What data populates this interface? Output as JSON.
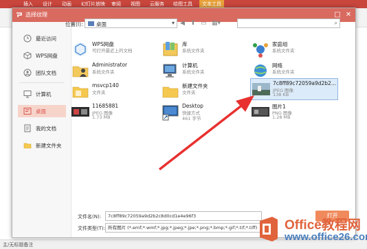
{
  "background_app": {
    "ribbon_tabs": [
      "插入",
      "设计",
      "动画",
      "幻灯片放映",
      "审阅",
      "视图",
      "云服务",
      "绘图工具",
      "文本工具"
    ],
    "status_text": "主/无标题备注",
    "accent_color": "#c9463d"
  },
  "dialog": {
    "title": "选择纹理",
    "titlebar_color": "#d96a5f",
    "buttons": {
      "maximize": "□",
      "close": "✕"
    }
  },
  "sidebar": {
    "items": [
      {
        "label": "最近访问",
        "icon": "clock-icon"
      },
      {
        "label": "WPS网盘",
        "icon": "cloud-cube-icon"
      },
      {
        "label": "团队文档",
        "icon": "team-doc-icon"
      },
      {
        "label": "计算机",
        "icon": "computer-icon"
      },
      {
        "label": "桌面",
        "icon": "desktop-icon",
        "active": true
      },
      {
        "label": "我的文档",
        "icon": "my-documents-icon"
      },
      {
        "label": "新建文件夹",
        "icon": "folder-icon"
      }
    ]
  },
  "location": {
    "label": "位置(I):",
    "value": "桌面"
  },
  "files": [
    {
      "name": "WPS网盘",
      "type": "可打开最近上的文档",
      "size": "",
      "icon": "wps-cloud-icon"
    },
    {
      "name": "库",
      "type": "系统文件夹",
      "size": "",
      "icon": "library-icon"
    },
    {
      "name": "家庭组",
      "type": "系统文件夹",
      "size": "",
      "icon": "homegroup-icon"
    },
    {
      "name": "Administrator",
      "type": "系统文件夹",
      "size": "",
      "icon": "user-folder-icon"
    },
    {
      "name": "计算机",
      "type": "系统文件夹",
      "size": "",
      "icon": "computer-icon"
    },
    {
      "name": "网络",
      "type": "系统文件夹",
      "size": "",
      "icon": "network-icon"
    },
    {
      "name": "msvcp140",
      "type": "文件夹",
      "size": "",
      "icon": "folder-icon"
    },
    {
      "name": "新建文件夹",
      "type": "文件夹",
      "size": "",
      "icon": "folder-icon"
    },
    {
      "name": "7c8ff89c72059a9d2b2c8d0cd...",
      "type": "JPEG 图像",
      "size": "138 KB",
      "icon": "image-thumbnail-icon",
      "selected": true
    },
    {
      "name": "11685881",
      "type": "JPEG 图像",
      "size": "1.73 MB",
      "icon": "image-thumbnail-icon"
    },
    {
      "name": "Desktop",
      "type": "快捷方式",
      "size": "461 字节",
      "icon": "shortcut-icon"
    },
    {
      "name": "图片1",
      "type": "PNG 图像",
      "size": "1.28 MB",
      "icon": "image-thumbnail-icon"
    }
  ],
  "footer": {
    "filename_label": "文件名(N):",
    "filename_value": "7c8ff89c72059a9d2b2c8d0cd1e4e96f3",
    "filetype_label": "文件类型(T):",
    "filetype_value": "所有图片 (*.emf;*.wmf;*.jpg;*.jpeg;*.jpe;*.png;*.bmp;*.gif;*.tif;*.tiff)",
    "open_label": "打开",
    "open_color": "#f08a5d"
  },
  "watermark": {
    "line1": "Office教程网",
    "line2": "www.office26.com"
  }
}
